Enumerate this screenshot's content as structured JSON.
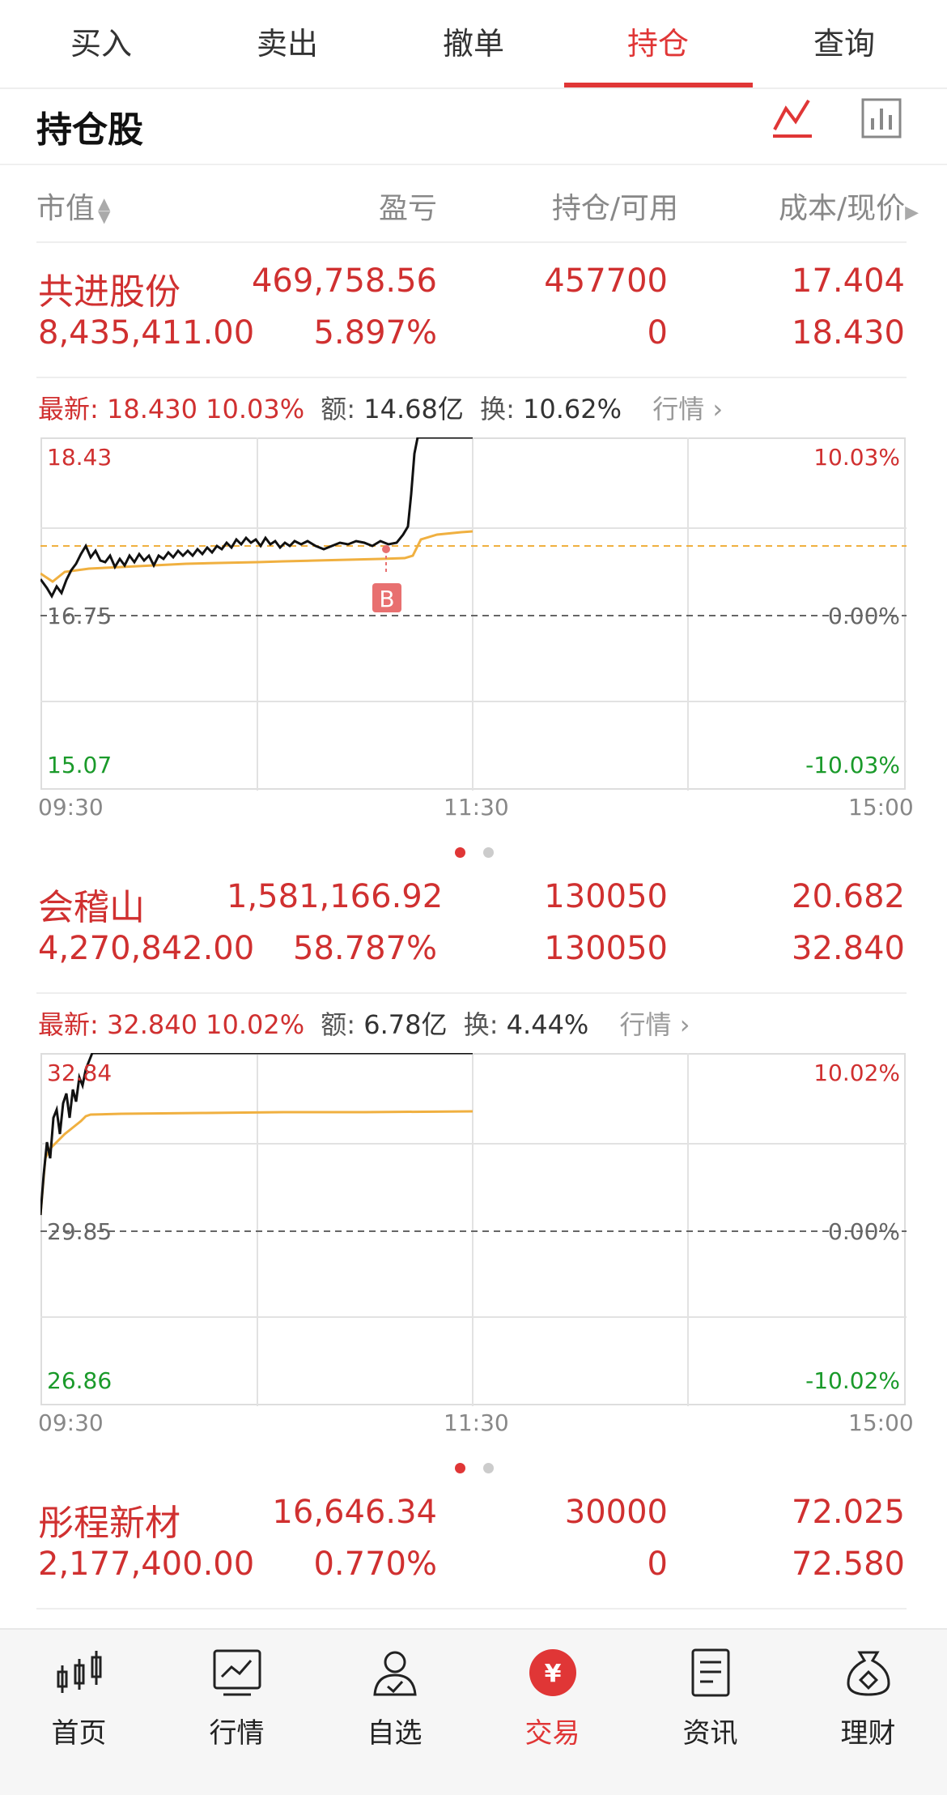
{
  "tabs": [
    "买入",
    "卖出",
    "撤单",
    "持仓",
    "查询"
  ],
  "active_tab": "持仓",
  "header": {
    "title": "持仓股"
  },
  "columns": {
    "market_value": "市值",
    "pnl": "盈亏",
    "position": "持仓/可用",
    "cost_price": "成本/现价"
  },
  "stocks": [
    {
      "name": "共进股份",
      "market_value": "8,435,411.00",
      "pnl": "469,758.56",
      "pnl_pct": "5.897%",
      "position": "457700",
      "available": "0",
      "cost": "17.404",
      "price": "18.430",
      "latest_label": "最新:",
      "latest_price": "18.430",
      "latest_pct": "10.03%",
      "amount_label": "额:",
      "amount": "14.68亿",
      "turnover_label": "换:",
      "turnover": "10.62%",
      "market_link": "行情",
      "chart": {
        "high": "18.43",
        "mid": "16.75",
        "low": "15.07",
        "high_pct": "10.03%",
        "mid_pct": "0.00%",
        "low_pct": "-10.03%",
        "marker": "B"
      }
    },
    {
      "name": "会稽山",
      "market_value": "4,270,842.00",
      "pnl": "1,581,166.92",
      "pnl_pct": "58.787%",
      "position": "130050",
      "available": "130050",
      "cost": "20.682",
      "price": "32.840",
      "latest_label": "最新:",
      "latest_price": "32.840",
      "latest_pct": "10.02%",
      "amount_label": "额:",
      "amount": "6.78亿",
      "turnover_label": "换:",
      "turnover": "4.44%",
      "market_link": "行情",
      "chart": {
        "high": "32.84",
        "mid": "29.85",
        "low": "26.86",
        "high_pct": "10.02%",
        "mid_pct": "0.00%",
        "low_pct": "-10.02%"
      }
    },
    {
      "name": "彤程新材",
      "market_value": "2,177,400.00",
      "pnl": "16,646.34",
      "pnl_pct": "0.770%",
      "position": "30000",
      "available": "0",
      "cost": "72.025",
      "price": "72.580"
    }
  ],
  "time_axis": [
    "09:30",
    "11:30",
    "15:00"
  ],
  "nav": [
    "首页",
    "行情",
    "自选",
    "交易",
    "资讯",
    "理财"
  ],
  "active_nav": "交易",
  "colors": {
    "accent": "#e03636",
    "up": "#d03030",
    "down": "#1a9a2a",
    "avg_line": "#f0b040"
  }
}
